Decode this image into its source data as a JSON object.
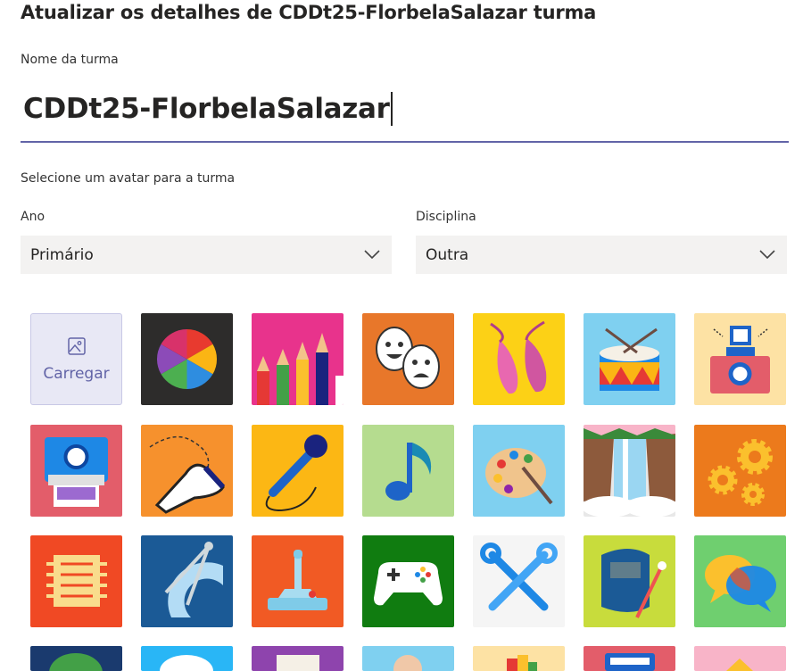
{
  "dialog": {
    "title": "Atualizar os detalhes de CDDt25-FlorbelaSalazar turma"
  },
  "class_name": {
    "label": "Nome da turma",
    "value": "CDDt25-FlorbelaSalazar"
  },
  "avatar": {
    "prompt": "Selecione um avatar para a turma",
    "upload_label": "Carregar"
  },
  "year": {
    "label": "Ano",
    "selected": "Primário"
  },
  "subject": {
    "label": "Disciplina",
    "selected": "Outra"
  },
  "avatar_tiles": [
    {
      "name": "color-wheel",
      "color": "#2d2c2b"
    },
    {
      "name": "colored-pencils",
      "color": "#e8338c"
    },
    {
      "name": "theater-masks",
      "color": "#e8772a"
    },
    {
      "name": "ballet-shoes",
      "color": "#fcd116"
    },
    {
      "name": "drum",
      "color": "#7fd0f0"
    },
    {
      "name": "camera",
      "color": "#fde2a4"
    },
    {
      "name": "instant-camera",
      "color": "#e35d6a"
    },
    {
      "name": "dance-shoe",
      "color": "#f6912d"
    },
    {
      "name": "microphone",
      "color": "#fcb714"
    },
    {
      "name": "music-note",
      "color": "#b5dc8f"
    },
    {
      "name": "paint-palette",
      "color": "#7fd0f0"
    },
    {
      "name": "waterfall",
      "color": "#e8e8e8"
    },
    {
      "name": "gears",
      "color": "#ec7a1c"
    },
    {
      "name": "circuit-chip",
      "color": "#f04924"
    },
    {
      "name": "compass-protractor",
      "color": "#1b5a96"
    },
    {
      "name": "joystick",
      "color": "#f15a24"
    },
    {
      "name": "game-controller",
      "color": "#107c10"
    },
    {
      "name": "wrenches",
      "color": "#f5f5f5"
    },
    {
      "name": "welding-mask",
      "color": "#c8dc3c"
    },
    {
      "name": "chat-bubbles",
      "color": "#6fcf6f"
    }
  ]
}
